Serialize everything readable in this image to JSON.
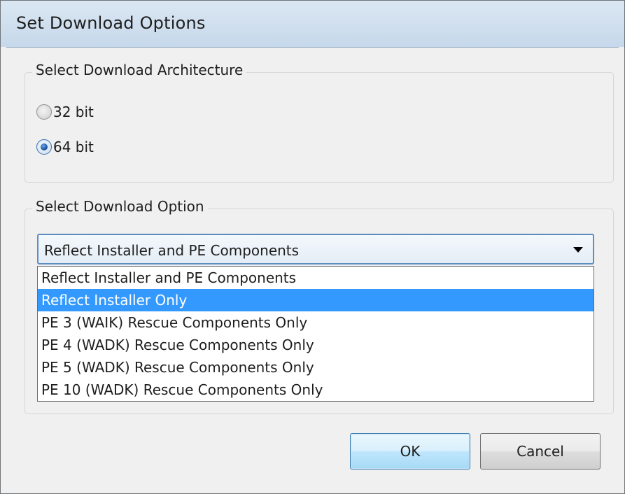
{
  "window": {
    "title": "Set Download Options"
  },
  "architecture": {
    "legend": "Select Download Architecture",
    "options": [
      {
        "label": "32 bit",
        "checked": false
      },
      {
        "label": "64 bit",
        "checked": true
      }
    ]
  },
  "download_option": {
    "legend": "Select Download Option",
    "selected_value": "Reflect Installer and PE Components",
    "items": [
      {
        "label": "Reflect Installer and PE Components",
        "highlighted": false
      },
      {
        "label": "Reflect Installer Only",
        "highlighted": true
      },
      {
        "label": "PE 3 (WAIK) Rescue Components Only",
        "highlighted": false
      },
      {
        "label": "PE 4 (WADK) Rescue Components Only",
        "highlighted": false
      },
      {
        "label": "PE 5 (WADK) Rescue Components Only",
        "highlighted": false
      },
      {
        "label": "PE 10 (WADK) Rescue Components Only",
        "highlighted": false
      }
    ],
    "dropdown_icon": "chevron-down-icon"
  },
  "buttons": {
    "ok_label": "OK",
    "cancel_label": "Cancel"
  },
  "colors": {
    "highlight": "#3399ff",
    "titlebar": "#d2e1f0",
    "default_button": "#bee6fd"
  }
}
